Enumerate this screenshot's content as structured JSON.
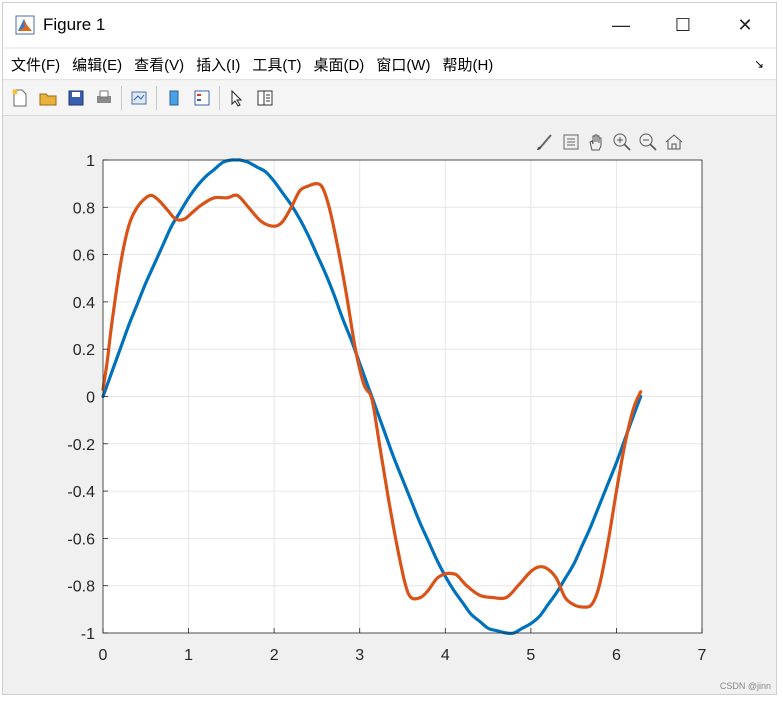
{
  "window": {
    "title": "Figure 1",
    "controls": {
      "minimize": "—",
      "maximize": "☐",
      "close": "✕"
    }
  },
  "menubar": {
    "items": [
      "文件(F)",
      "编辑(E)",
      "查看(V)",
      "插入(I)",
      "工具(T)",
      "桌面(D)",
      "窗口(W)",
      "帮助(H)"
    ],
    "overflow_icon": "arrow-icon"
  },
  "toolbar": {
    "buttons": [
      "new-figure-icon",
      "open-icon",
      "save-icon",
      "print-icon",
      "link-plot-icon",
      "colorbar-icon",
      "legend-icon",
      "pointer-icon",
      "property-inspector-icon"
    ]
  },
  "axes_toolbar": {
    "buttons": [
      "brush-icon",
      "data-tips-icon",
      "pan-icon",
      "zoom-in-icon",
      "zoom-out-icon",
      "home-icon"
    ]
  },
  "watermark": "CSDN @jinn",
  "chart_data": {
    "type": "line",
    "title": "",
    "xlabel": "",
    "ylabel": "",
    "xlim": [
      0,
      7
    ],
    "ylim": [
      -1,
      1
    ],
    "grid": true,
    "xticks": [
      "0",
      "1",
      "2",
      "3",
      "4",
      "5",
      "6",
      "7"
    ],
    "yticks": [
      "-1",
      "-0.8",
      "-0.6",
      "-0.4",
      "-0.2",
      "0",
      "0.2",
      "0.4",
      "0.6",
      "0.8",
      "1"
    ],
    "series": [
      {
        "color": "#0072bd",
        "x": [
          0,
          0.1,
          0.2,
          0.3,
          0.4,
          0.5,
          0.6,
          0.7,
          0.8,
          0.9,
          1.0,
          1.1,
          1.2,
          1.3,
          1.4,
          1.5,
          1.5708,
          1.6,
          1.7,
          1.8,
          1.9,
          2.0,
          2.1,
          2.2,
          2.3,
          2.4,
          2.5,
          2.6,
          2.7,
          2.8,
          2.9,
          3.0,
          3.1,
          3.1416,
          3.2,
          3.3,
          3.4,
          3.5,
          3.6,
          3.7,
          3.8,
          3.9,
          4.0,
          4.1,
          4.2,
          4.3,
          4.4,
          4.5,
          4.6,
          4.7124,
          4.8,
          4.9,
          5.0,
          5.1,
          5.2,
          5.3,
          5.4,
          5.5,
          5.6,
          5.7,
          5.8,
          5.9,
          6.0,
          6.1,
          6.2,
          6.2832
        ],
        "y": [
          0,
          0.1,
          0.2,
          0.3,
          0.39,
          0.48,
          0.56,
          0.64,
          0.72,
          0.78,
          0.84,
          0.89,
          0.93,
          0.96,
          0.99,
          1.0,
          1.0,
          1.0,
          0.99,
          0.97,
          0.95,
          0.91,
          0.86,
          0.81,
          0.75,
          0.68,
          0.6,
          0.52,
          0.43,
          0.33,
          0.24,
          0.14,
          0.04,
          0,
          -0.06,
          -0.16,
          -0.26,
          -0.35,
          -0.44,
          -0.53,
          -0.61,
          -0.69,
          -0.76,
          -0.82,
          -0.87,
          -0.92,
          -0.95,
          -0.98,
          -0.99,
          -1.0,
          -1.0,
          -0.98,
          -0.96,
          -0.93,
          -0.88,
          -0.83,
          -0.77,
          -0.71,
          -0.63,
          -0.55,
          -0.46,
          -0.37,
          -0.28,
          -0.18,
          -0.08,
          0
        ]
      },
      {
        "color": "#d95319",
        "x": [
          0,
          0.05,
          0.1,
          0.2,
          0.3,
          0.4,
          0.5,
          0.57,
          0.65,
          0.75,
          0.85,
          0.95,
          1.05,
          1.15,
          1.3,
          1.45,
          1.5708,
          1.7,
          1.85,
          2.0,
          2.1,
          2.2,
          2.3,
          2.4,
          2.5,
          2.57,
          2.65,
          2.75,
          2.85,
          2.95,
          3.05,
          3.1416,
          3.23,
          3.33,
          3.43,
          3.53,
          3.6,
          3.71,
          3.8,
          3.9,
          4.0,
          4.1,
          4.15,
          4.25,
          4.4,
          4.55,
          4.7124,
          4.85,
          5.0,
          5.1,
          5.2,
          5.3,
          5.4,
          5.5,
          5.6,
          5.71,
          5.8,
          5.9,
          6.0,
          6.1,
          6.2,
          6.2832
        ],
        "y": [
          0.03,
          0.15,
          0.3,
          0.55,
          0.72,
          0.8,
          0.84,
          0.85,
          0.83,
          0.79,
          0.75,
          0.75,
          0.78,
          0.81,
          0.84,
          0.84,
          0.85,
          0.8,
          0.74,
          0.72,
          0.74,
          0.8,
          0.87,
          0.89,
          0.9,
          0.88,
          0.79,
          0.62,
          0.42,
          0.2,
          0.05,
          -0.01,
          -0.2,
          -0.42,
          -0.62,
          -0.79,
          -0.85,
          -0.85,
          -0.82,
          -0.77,
          -0.75,
          -0.75,
          -0.76,
          -0.8,
          -0.84,
          -0.85,
          -0.85,
          -0.8,
          -0.74,
          -0.72,
          -0.73,
          -0.77,
          -0.85,
          -0.88,
          -0.89,
          -0.88,
          -0.8,
          -0.62,
          -0.4,
          -0.2,
          -0.05,
          0.02
        ]
      }
    ]
  }
}
